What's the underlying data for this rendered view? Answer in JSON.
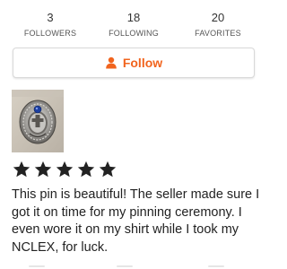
{
  "stats": [
    {
      "value": "3",
      "label": "FOLLOWERS"
    },
    {
      "value": "18",
      "label": "FOLLOWING"
    },
    {
      "value": "20",
      "label": "FAVORITES"
    }
  ],
  "follow_button": {
    "label": "Follow",
    "icon": "person-icon",
    "color": "#f1641e"
  },
  "review": {
    "rating": 5,
    "max_rating": 5,
    "text": "This pin is beautiful! The seller made sure I got it on time for my pinning ceremony. I even wore it on my shirt while I took my NCLEX, for luck."
  }
}
